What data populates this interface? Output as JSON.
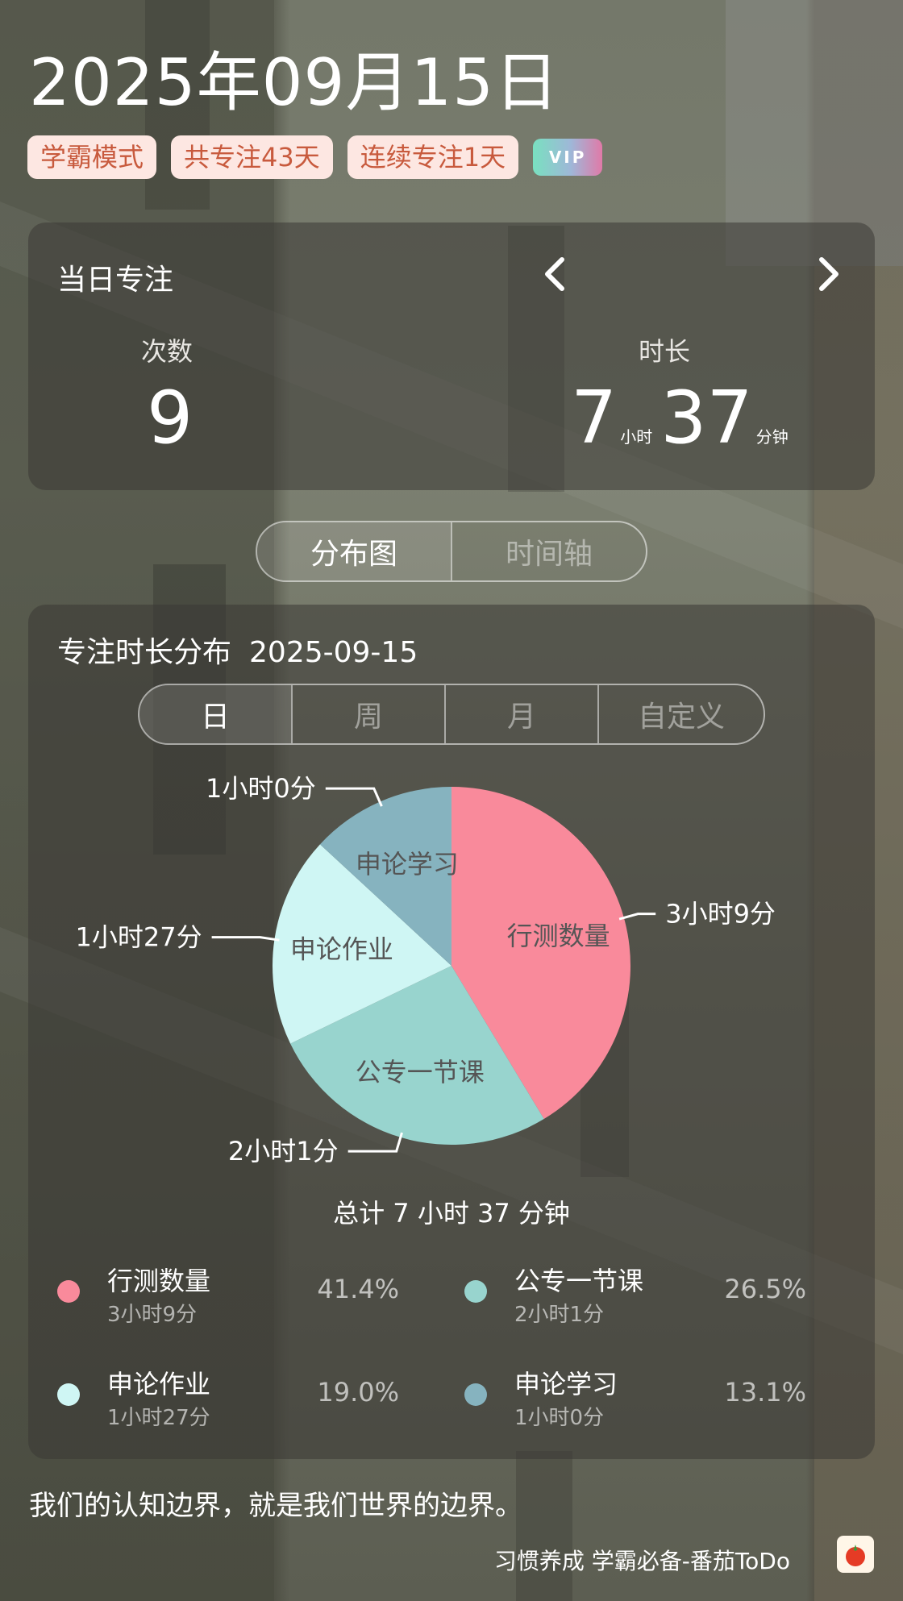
{
  "header": {
    "date_title": "2025年09月15日",
    "badges": [
      "学霸模式",
      "共专注43天",
      "连续专注1天"
    ],
    "vip_label": "VIP"
  },
  "focus": {
    "title": "当日专注",
    "count_label": "次数",
    "count_value": "9",
    "duration_label": "时长",
    "hours": "7",
    "hours_unit": "小时",
    "minutes": "37",
    "minutes_unit": "分钟"
  },
  "view_tabs": [
    {
      "label": "分布图",
      "active": true
    },
    {
      "label": "时间轴",
      "active": false
    }
  ],
  "distribution": {
    "title": "专注时长分布",
    "date": "2025-09-15",
    "period_tabs": [
      {
        "label": "日",
        "active": true
      },
      {
        "label": "周",
        "active": false
      },
      {
        "label": "月",
        "active": false
      },
      {
        "label": "自定义",
        "active": false
      }
    ],
    "total_text": "总计 7 小时 37 分钟"
  },
  "chart_data": {
    "type": "pie",
    "slices": [
      {
        "name": "行测数量",
        "value": 189,
        "duration": "3小时9分",
        "percent": "41.4%",
        "color": "#f98a9b"
      },
      {
        "name": "公专一节课",
        "value": 121,
        "duration": "2小时1分",
        "percent": "26.5%",
        "color": "#98d4ce"
      },
      {
        "name": "申论作业",
        "value": 87,
        "duration": "1小时27分",
        "percent": "19.0%",
        "color": "#cff6f4"
      },
      {
        "name": "申论学习",
        "value": 60,
        "duration": "1小时0分",
        "percent": "13.1%",
        "color": "#86b3bf"
      }
    ]
  },
  "quote": "我们的认知边界，就是我们世界的边界。",
  "footer": {
    "text": "习惯养成 学霸必备-番茄ToDo",
    "logo": "tomato-icon"
  }
}
